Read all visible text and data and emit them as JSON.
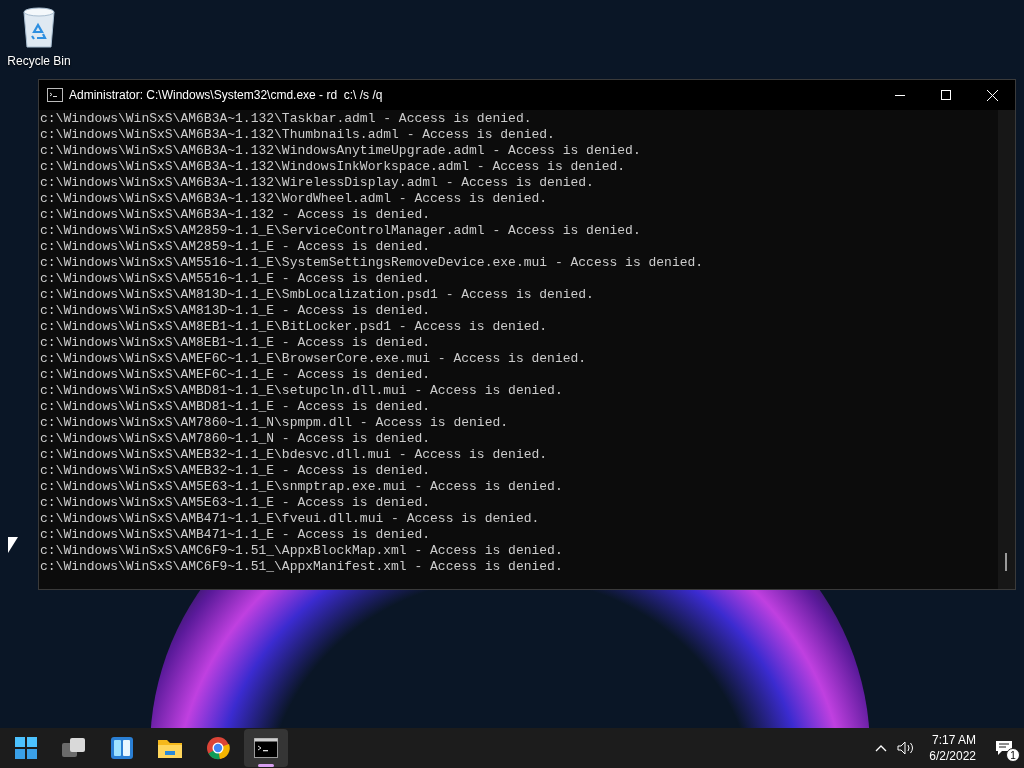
{
  "desktop_icons": [
    {
      "label": "Recycle Bin",
      "kind": "recycle-bin"
    }
  ],
  "window": {
    "title": "Administrator: C:\\Windows\\System32\\cmd.exe - rd  c:\\ /s /q",
    "lines": [
      "c:\\Windows\\WinSxS\\AM6B3A~1.132\\Taskbar.adml - Access is denied.",
      "c:\\Windows\\WinSxS\\AM6B3A~1.132\\Thumbnails.adml - Access is denied.",
      "c:\\Windows\\WinSxS\\AM6B3A~1.132\\WindowsAnytimeUpgrade.adml - Access is denied.",
      "c:\\Windows\\WinSxS\\AM6B3A~1.132\\WindowsInkWorkspace.adml - Access is denied.",
      "c:\\Windows\\WinSxS\\AM6B3A~1.132\\WirelessDisplay.adml - Access is denied.",
      "c:\\Windows\\WinSxS\\AM6B3A~1.132\\WordWheel.adml - Access is denied.",
      "c:\\Windows\\WinSxS\\AM6B3A~1.132 - Access is denied.",
      "c:\\Windows\\WinSxS\\AM2859~1.1_E\\ServiceControlManager.adml - Access is denied.",
      "c:\\Windows\\WinSxS\\AM2859~1.1_E - Access is denied.",
      "c:\\Windows\\WinSxS\\AM5516~1.1_E\\SystemSettingsRemoveDevice.exe.mui - Access is denied.",
      "c:\\Windows\\WinSxS\\AM5516~1.1_E - Access is denied.",
      "c:\\Windows\\WinSxS\\AM813D~1.1_E\\SmbLocalization.psd1 - Access is denied.",
      "c:\\Windows\\WinSxS\\AM813D~1.1_E - Access is denied.",
      "c:\\Windows\\WinSxS\\AM8EB1~1.1_E\\BitLocker.psd1 - Access is denied.",
      "c:\\Windows\\WinSxS\\AM8EB1~1.1_E - Access is denied.",
      "c:\\Windows\\WinSxS\\AMEF6C~1.1_E\\BrowserCore.exe.mui - Access is denied.",
      "c:\\Windows\\WinSxS\\AMEF6C~1.1_E - Access is denied.",
      "c:\\Windows\\WinSxS\\AMBD81~1.1_E\\setupcln.dll.mui - Access is denied.",
      "c:\\Windows\\WinSxS\\AMBD81~1.1_E - Access is denied.",
      "c:\\Windows\\WinSxS\\AM7860~1.1_N\\spmpm.dll - Access is denied.",
      "c:\\Windows\\WinSxS\\AM7860~1.1_N - Access is denied.",
      "c:\\Windows\\WinSxS\\AMEB32~1.1_E\\bdesvc.dll.mui - Access is denied.",
      "c:\\Windows\\WinSxS\\AMEB32~1.1_E - Access is denied.",
      "c:\\Windows\\WinSxS\\AM5E63~1.1_E\\snmptrap.exe.mui - Access is denied.",
      "c:\\Windows\\WinSxS\\AM5E63~1.1_E - Access is denied.",
      "c:\\Windows\\WinSxS\\AMB471~1.1_E\\fveui.dll.mui - Access is denied.",
      "c:\\Windows\\WinSxS\\AMB471~1.1_E - Access is denied.",
      "c:\\Windows\\WinSxS\\AMC6F9~1.51_\\AppxBlockMap.xml - Access is denied.",
      "c:\\Windows\\WinSxS\\AMC6F9~1.51_\\AppxManifest.xml - Access is denied."
    ]
  },
  "taskbar": {
    "apps": [
      {
        "kind": "start",
        "selected": false
      },
      {
        "kind": "task-view",
        "selected": false
      },
      {
        "kind": "widgets",
        "selected": false
      },
      {
        "kind": "explorer",
        "selected": false
      },
      {
        "kind": "browser",
        "selected": false
      },
      {
        "kind": "terminal",
        "selected": true
      }
    ],
    "clock": {
      "time": "7:17 AM",
      "date": "6/2/2022"
    },
    "notifications": {
      "count": "1"
    }
  }
}
